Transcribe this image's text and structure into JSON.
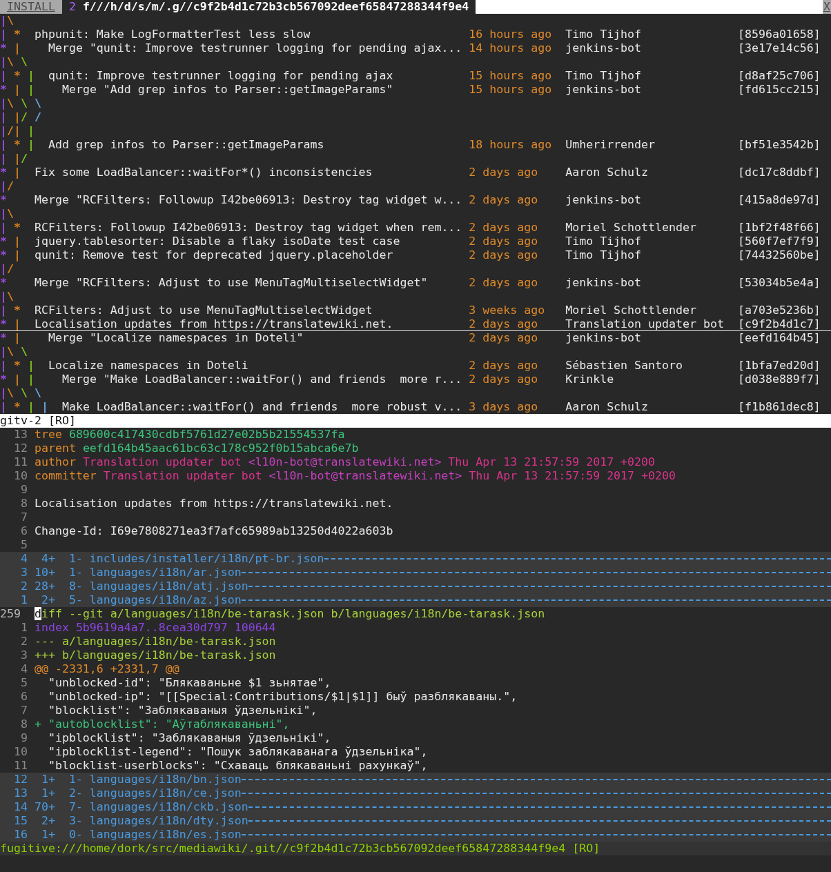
{
  "tabline": {
    "tabs": [
      {
        "label": "INSTALL",
        "selected": false
      },
      {
        "count": "2",
        "label": "f///h/d/s/m/.g//c9f2b4d1c72b3cb567092deef65847288344f9e4",
        "selected": true
      }
    ],
    "close": "X"
  },
  "log": {
    "rows": [
      {
        "kind": "graph",
        "selected": false,
        "graph": [
          {
            "text": "|",
            "color": "#9b4de0"
          },
          {
            "text": "\\",
            "color": "#d7821e"
          }
        ]
      },
      {
        "kind": "commit",
        "selected": false,
        "graph": [
          {
            "text": "|",
            "color": "#9b4de0"
          },
          {
            "text": " *",
            "color": "#d7821e"
          }
        ],
        "message": "phpunit: Make LogFormatterTest less slow",
        "date": "16 hours ago",
        "author": "Timo Tijhof",
        "hash": "[8596a01658]"
      },
      {
        "kind": "merge",
        "selected": false,
        "graph": [
          {
            "text": "*",
            "color": "#9b4de0"
          },
          {
            "text": " |",
            "color": "#d7821e"
          }
        ],
        "message": "Merge \"qunit: Improve testrunner logging for pending ajax...",
        "date": "14 hours ago",
        "author": "jenkins-bot",
        "hash": "[3e17e14c56]"
      },
      {
        "kind": "graph",
        "selected": false,
        "graph": [
          {
            "text": "|",
            "color": "#9b4de0"
          },
          {
            "text": "\\",
            "color": "#d7821e"
          },
          {
            "text": " \\",
            "color": "#80c41c"
          }
        ]
      },
      {
        "kind": "commit",
        "selected": false,
        "graph": [
          {
            "text": "|",
            "color": "#9b4de0"
          },
          {
            "text": " *",
            "color": "#d7821e"
          },
          {
            "text": " |",
            "color": "#80c41c"
          }
        ],
        "message": "qunit: Improve testrunner logging for pending ajax",
        "date": "15 hours ago",
        "author": "Timo Tijhof",
        "hash": "[d8af25c706]"
      },
      {
        "kind": "merge",
        "selected": false,
        "graph": [
          {
            "text": "*",
            "color": "#9b4de0"
          },
          {
            "text": " |",
            "color": "#d7821e"
          },
          {
            "text": " |",
            "color": "#80c41c"
          }
        ],
        "message": "Merge \"Add grep infos to Parser::getImageParams\"",
        "date": "15 hours ago",
        "author": "jenkins-bot",
        "hash": "[fd615cc215]"
      },
      {
        "kind": "graph",
        "selected": false,
        "graph": [
          {
            "text": "|",
            "color": "#9b4de0"
          },
          {
            "text": "\\",
            "color": "#d7821e"
          },
          {
            "text": " \\",
            "color": "#80c41c"
          },
          {
            "text": " \\",
            "color": "#6aa9e6"
          }
        ]
      },
      {
        "kind": "graph",
        "selected": false,
        "graph": [
          {
            "text": "|",
            "color": "#9b4de0"
          },
          {
            "text": " |",
            "color": "#d7821e"
          },
          {
            "text": "/",
            "color": "#80c41c"
          },
          {
            "text": " /",
            "color": "#6aa9e6"
          }
        ]
      },
      {
        "kind": "graph",
        "selected": false,
        "graph": [
          {
            "text": "|",
            "color": "#9b4de0"
          },
          {
            "text": "/|",
            "color": "#d7821e"
          },
          {
            "text": " |",
            "color": "#80c41c"
          }
        ]
      },
      {
        "kind": "commit",
        "selected": false,
        "graph": [
          {
            "text": "|",
            "color": "#9b4de0"
          },
          {
            "text": " *",
            "color": "#d7821e"
          },
          {
            "text": " |",
            "color": "#80c41c"
          }
        ],
        "message": "Add grep infos to Parser::getImageParams",
        "date": "18 hours ago",
        "author": "Umherirrender",
        "hash": "[bf51e3542b]"
      },
      {
        "kind": "graph",
        "selected": false,
        "graph": [
          {
            "text": "|",
            "color": "#9b4de0"
          },
          {
            "text": " |",
            "color": "#d7821e"
          },
          {
            "text": "/",
            "color": "#80c41c"
          }
        ]
      },
      {
        "kind": "commit",
        "selected": false,
        "graph": [
          {
            "text": "*",
            "color": "#9b4de0"
          },
          {
            "text": " |",
            "color": "#d7821e"
          }
        ],
        "message": "Fix some LoadBalancer::waitFor*() inconsistencies",
        "date": "2 days ago",
        "author": "Aaron Schulz",
        "hash": "[dc17c8ddbf]"
      },
      {
        "kind": "graph",
        "selected": false,
        "graph": [
          {
            "text": "|",
            "color": "#9b4de0"
          },
          {
            "text": "/",
            "color": "#d7821e"
          }
        ]
      },
      {
        "kind": "merge",
        "selected": false,
        "graph": [
          {
            "text": "*",
            "color": "#9b4de0"
          }
        ],
        "message": "Merge \"RCFilters: Followup I42be06913: Destroy tag widget w...",
        "date": "2 days ago",
        "author": "jenkins-bot",
        "hash": "[415a8de97d]"
      },
      {
        "kind": "graph",
        "selected": false,
        "graph": [
          {
            "text": "|",
            "color": "#9b4de0"
          },
          {
            "text": "\\",
            "color": "#d7821e"
          }
        ]
      },
      {
        "kind": "commit",
        "selected": false,
        "graph": [
          {
            "text": "|",
            "color": "#9b4de0"
          },
          {
            "text": " *",
            "color": "#d7821e"
          }
        ],
        "message": "RCFilters: Followup I42be06913: Destroy tag widget when rem...",
        "date": "2 days ago",
        "author": "Moriel Schottlender",
        "hash": "[1bf2f48f66]"
      },
      {
        "kind": "commit",
        "selected": false,
        "graph": [
          {
            "text": "*",
            "color": "#9b4de0"
          },
          {
            "text": " |",
            "color": "#d7821e"
          }
        ],
        "message": "jquery.tablesorter: Disable a flaky isoDate test case",
        "date": "2 days ago",
        "author": "Timo Tijhof",
        "hash": "[560f7ef7f9]"
      },
      {
        "kind": "commit",
        "selected": false,
        "graph": [
          {
            "text": "*",
            "color": "#9b4de0"
          },
          {
            "text": " |",
            "color": "#d7821e"
          }
        ],
        "message": "qunit: Remove test for deprecated jquery.placeholder",
        "date": "2 days ago",
        "author": "Timo Tijhof",
        "hash": "[74432560be]"
      },
      {
        "kind": "graph",
        "selected": false,
        "graph": [
          {
            "text": "|",
            "color": "#9b4de0"
          },
          {
            "text": "/",
            "color": "#d7821e"
          }
        ]
      },
      {
        "kind": "merge",
        "selected": false,
        "graph": [
          {
            "text": "*",
            "color": "#9b4de0"
          }
        ],
        "message": "Merge \"RCFilters: Adjust to use MenuTagMultiselectWidget\"",
        "date": "2 days ago",
        "author": "jenkins-bot",
        "hash": "[53034b5e4a]"
      },
      {
        "kind": "graph",
        "selected": false,
        "graph": [
          {
            "text": "|",
            "color": "#9b4de0"
          },
          {
            "text": "\\",
            "color": "#d7821e"
          }
        ]
      },
      {
        "kind": "commit",
        "selected": false,
        "graph": [
          {
            "text": "|",
            "color": "#9b4de0"
          },
          {
            "text": " *",
            "color": "#d7821e"
          }
        ],
        "message": "RCFilters: Adjust to use MenuTagMultiselectWidget",
        "date": "3 weeks ago",
        "author": "Moriel Schottlender",
        "hash": "[a703e5236b]"
      },
      {
        "kind": "commit",
        "selected": true,
        "graph": [
          {
            "text": "*",
            "color": "#9b4de0"
          },
          {
            "text": " |",
            "color": "#d7821e"
          }
        ],
        "message": "Localisation updates from https://translatewiki.net.",
        "date": "2 days ago",
        "author": "Translation updater bot",
        "hash": "[c9f2b4d1c7]"
      },
      {
        "kind": "merge",
        "selected": false,
        "graph": [
          {
            "text": "*",
            "color": "#9b4de0"
          },
          {
            "text": " |",
            "color": "#d7821e"
          }
        ],
        "message": "Merge \"Localize namespaces in Doteli\"",
        "date": "2 days ago",
        "author": "jenkins-bot",
        "hash": "[eefd164b45]"
      },
      {
        "kind": "graph",
        "selected": false,
        "graph": [
          {
            "text": "|",
            "color": "#9b4de0"
          },
          {
            "text": "\\",
            "color": "#d7821e"
          },
          {
            "text": " \\",
            "color": "#80c41c"
          }
        ]
      },
      {
        "kind": "commit",
        "selected": false,
        "graph": [
          {
            "text": "|",
            "color": "#9b4de0"
          },
          {
            "text": " *",
            "color": "#d7821e"
          },
          {
            "text": " |",
            "color": "#80c41c"
          }
        ],
        "message": "Localize namespaces in Doteli",
        "date": "2 days ago",
        "author": "Sébastien Santoro",
        "hash": "[1bfa7ed20d]"
      },
      {
        "kind": "merge",
        "selected": false,
        "graph": [
          {
            "text": "*",
            "color": "#9b4de0"
          },
          {
            "text": " |",
            "color": "#d7821e"
          },
          {
            "text": " |",
            "color": "#80c41c"
          }
        ],
        "message": "Merge \"Make LoadBalancer::waitFor() and friends  more r...",
        "date": "2 days ago",
        "author": "Krinkle",
        "hash": "[d038e889f7]"
      },
      {
        "kind": "graph",
        "selected": false,
        "graph": [
          {
            "text": "|",
            "color": "#9b4de0"
          },
          {
            "text": "\\",
            "color": "#d7821e"
          },
          {
            "text": " \\",
            "color": "#80c41c"
          },
          {
            "text": " \\",
            "color": "#6aa9e6"
          }
        ]
      },
      {
        "kind": "commit",
        "selected": false,
        "graph": [
          {
            "text": "|",
            "color": "#9b4de0"
          },
          {
            "text": " *",
            "color": "#d7821e"
          },
          {
            "text": " |",
            "color": "#80c41c"
          },
          {
            "text": " |",
            "color": "#6aa9e6"
          }
        ],
        "message": "Make LoadBalancer::waitFor() and friends  more robust v...",
        "date": "3 days ago",
        "author": "Aaron Schulz",
        "hash": "[f1b861dec8]"
      }
    ]
  },
  "log_status": {
    "text": "gitv-2 [RO]",
    "active": false
  },
  "commit": {
    "lines": [
      {
        "number": "13",
        "kind": "text",
        "selected": false,
        "segments": [
          {
            "text": "tree",
            "color": "#e08a2a"
          },
          {
            "text": "689600c417430cdbf5761d27e02b5b21554537fa",
            "color": "#3cc47c"
          }
        ]
      },
      {
        "number": "12",
        "kind": "text",
        "selected": false,
        "segments": [
          {
            "text": "parent",
            "color": "#e08a2a"
          },
          {
            "text": "eefd164b45aac61bc63c178c952f0b15abca6e7b",
            "color": "#3cc47c"
          }
        ]
      },
      {
        "number": "11",
        "kind": "text",
        "selected": false,
        "segments": [
          {
            "text": "author",
            "color": "#e08a2a"
          },
          {
            "text": "Translation updater bot",
            "color": "#d9338c"
          },
          {
            "text": "<l10n-bot@translatewiki.net>",
            "color": "#c640c0"
          },
          {
            "text": "Thu Apr 13 21:57:59 2017 +0200",
            "color": "#d9338c"
          }
        ]
      },
      {
        "number": "10",
        "kind": "text",
        "selected": false,
        "segments": [
          {
            "text": "committer",
            "color": "#e08a2a"
          },
          {
            "text": "Translation updater bot",
            "color": "#d9338c"
          },
          {
            "text": "<l10n-bot@translatewiki.net>",
            "color": "#c640c0"
          },
          {
            "text": "Thu Apr 13 21:57:59 2017 +0200",
            "color": "#d9338c"
          }
        ]
      },
      {
        "number": "9",
        "kind": "text",
        "selected": false
      },
      {
        "number": "8",
        "kind": "text",
        "selected": false,
        "segments": [
          {
            "text": "Localisation updates from https://translatewiki.net.",
            "color": "#e8e8e8"
          }
        ]
      },
      {
        "number": "7",
        "kind": "text",
        "selected": false
      },
      {
        "number": "6",
        "kind": "text",
        "selected": false,
        "segments": [
          {
            "text": "Change-Id: I69e7808271ea3f7afc65989ab13250d4022a603b",
            "color": "#e8e8e8"
          }
        ]
      },
      {
        "number": "5",
        "kind": "text",
        "selected": false
      },
      {
        "number": "4",
        "kind": "fold",
        "selected": false,
        "added": "4+",
        "removed": "1-",
        "path": "includes/installer/i18n/pt-br.json"
      },
      {
        "number": "3",
        "kind": "fold",
        "selected": false,
        "added": "10+",
        "removed": "1-",
        "path": "languages/i18n/ar.json"
      },
      {
        "number": "2",
        "kind": "fold",
        "selected": false,
        "added": "28+",
        "removed": "8-",
        "path": "languages/i18n/atj.json"
      },
      {
        "number": "1",
        "kind": "fold",
        "selected": false,
        "added": "2+",
        "removed": "5-",
        "path": "languages/i18n/az.json"
      },
      {
        "number": "259",
        "kind": "text",
        "selected": true,
        "segments": [
          {
            "text": "diff --git a/languages/i18n/be-tarask.json b/languages/i18n/be-tarask.json",
            "color": "#a6d13a"
          }
        ]
      },
      {
        "number": "1",
        "kind": "text",
        "selected": false,
        "segments": [
          {
            "text": "index 5b9619a4a7..8cea30d797 100644",
            "color": "#8a44e0"
          }
        ]
      },
      {
        "number": "2",
        "kind": "text",
        "selected": false,
        "segments": [
          {
            "text": "--- a/languages/i18n/be-tarask.json",
            "color": "#a6d13a"
          }
        ]
      },
      {
        "number": "3",
        "kind": "text",
        "selected": false,
        "segments": [
          {
            "text": "+++ b/languages/i18n/be-tarask.json",
            "color": "#a6d13a"
          }
        ]
      },
      {
        "number": "4",
        "kind": "text",
        "selected": false,
        "segments": [
          {
            "text": "@@ -2331,6 +2331,7 @@",
            "color": "#e08a2a"
          }
        ]
      },
      {
        "number": "5",
        "kind": "context",
        "selected": false,
        "segments": [
          {
            "text": "\"unblocked-id\": \"Блякаваньне $1 зьнятае\",",
            "color": "#e8e8e8"
          }
        ]
      },
      {
        "number": "6",
        "kind": "context",
        "selected": false,
        "segments": [
          {
            "text": "\"unblocked-ip\": \"[[Special:Contributions/$1|$1]] быў разблякаваны.\",",
            "color": "#e8e8e8"
          }
        ]
      },
      {
        "number": "7",
        "kind": "context",
        "selected": false,
        "segments": [
          {
            "text": "\"blocklist\": \"Заблякаваныя ўдзельнікі\",",
            "color": "#e8e8e8"
          }
        ]
      },
      {
        "number": "8",
        "kind": "text",
        "selected": false,
        "segments": [
          {
            "text": "+ \"autoblocklist\": \"Аўтаблякаваньні\",",
            "color": "#3cc47c"
          }
        ]
      },
      {
        "number": "9",
        "kind": "context",
        "selected": false,
        "segments": [
          {
            "text": "\"ipblocklist\": \"Заблякаваныя ўдзельнікі\",",
            "color": "#e8e8e8"
          }
        ]
      },
      {
        "number": "10",
        "kind": "context",
        "selected": false,
        "segments": [
          {
            "text": "\"ipblocklist-legend\": \"Пошук заблякаванага ўдзельніка\",",
            "color": "#e8e8e8"
          }
        ]
      },
      {
        "number": "11",
        "kind": "context",
        "selected": false,
        "segments": [
          {
            "text": "\"blocklist-userblocks\": \"Схаваць блякаваньні рахункаў\",",
            "color": "#e8e8e8"
          }
        ]
      },
      {
        "number": "12",
        "kind": "fold",
        "selected": false,
        "added": "1+",
        "removed": "1-",
        "path": "languages/i18n/bn.json"
      },
      {
        "number": "13",
        "kind": "fold",
        "selected": false,
        "added": "1+",
        "removed": "2-",
        "path": "languages/i18n/ce.json"
      },
      {
        "number": "14",
        "kind": "fold",
        "selected": false,
        "added": "70+",
        "removed": "7-",
        "path": "languages/i18n/ckb.json"
      },
      {
        "number": "15",
        "kind": "fold",
        "selected": false,
        "added": "2+",
        "removed": "3-",
        "path": "languages/i18n/dty.json"
      },
      {
        "number": "16",
        "kind": "fold",
        "selected": false,
        "added": "1+",
        "removed": "0-",
        "path": "languages/i18n/es.json"
      }
    ]
  },
  "commit_status": {
    "text": "fugitive:///home/dork/src/mediawiki/.git//c9f2b4d1c72b3cb567092deef65847288344f9e4 [RO]",
    "active": true
  }
}
